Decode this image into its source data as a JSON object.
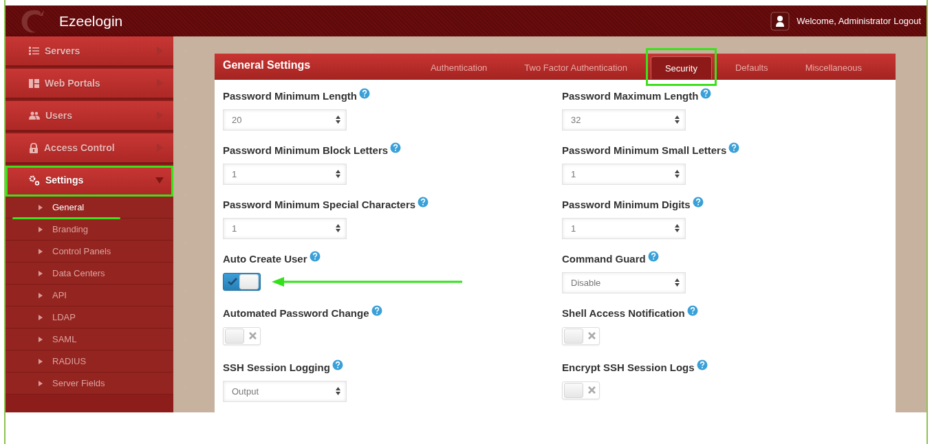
{
  "header": {
    "app_name": "Ezeelogin",
    "welcome": "Welcome, Administrator",
    "logout": "Logout"
  },
  "sidebar": {
    "items": [
      {
        "label": "Servers",
        "expanded": false,
        "highlighted": false
      },
      {
        "label": "Web Portals",
        "expanded": false,
        "highlighted": false
      },
      {
        "label": "Users",
        "expanded": false,
        "highlighted": false
      },
      {
        "label": "Access Control",
        "expanded": false,
        "highlighted": false
      },
      {
        "label": "Settings",
        "expanded": true,
        "highlighted": true,
        "children": [
          {
            "label": "General",
            "selected": true,
            "underlined": true
          },
          {
            "label": "Branding",
            "selected": false,
            "underlined": false
          },
          {
            "label": "Control Panels",
            "selected": false,
            "underlined": false
          },
          {
            "label": "Data Centers",
            "selected": false,
            "underlined": false
          },
          {
            "label": "API",
            "selected": false,
            "underlined": false
          },
          {
            "label": "LDAP",
            "selected": false,
            "underlined": false
          },
          {
            "label": "SAML",
            "selected": false,
            "underlined": false
          },
          {
            "label": "RADIUS",
            "selected": false,
            "underlined": false
          },
          {
            "label": "Server Fields",
            "selected": false,
            "underlined": false
          }
        ]
      }
    ]
  },
  "panel": {
    "title": "General Settings",
    "tabs": [
      {
        "label": "Authentication",
        "selected": false,
        "highlighted": false
      },
      {
        "label": "Two Factor Authentication",
        "selected": false,
        "highlighted": false
      },
      {
        "label": "Security",
        "selected": true,
        "highlighted": true
      },
      {
        "label": "Defaults",
        "selected": false,
        "highlighted": false
      },
      {
        "label": "Miscellaneous",
        "selected": false,
        "highlighted": false
      }
    ],
    "left_fields": [
      {
        "label": "Password Minimum Length",
        "kind": "select",
        "value": "20",
        "annotated": false
      },
      {
        "label": "Password Minimum Block Letters",
        "kind": "select",
        "value": "1",
        "annotated": false
      },
      {
        "label": "Password Minimum Special Characters",
        "kind": "select",
        "value": "1",
        "annotated": false
      },
      {
        "label": "Auto Create User",
        "kind": "toggle",
        "on": true,
        "annotated": true
      },
      {
        "label": "Automated Password Change",
        "kind": "toggle",
        "on": false,
        "annotated": false
      },
      {
        "label": "SSH Session Logging",
        "kind": "select",
        "value": "Output",
        "annotated": false
      }
    ],
    "right_fields": [
      {
        "label": "Password Maximum Length",
        "kind": "select",
        "value": "32",
        "annotated": false
      },
      {
        "label": "Password Minimum Small Letters",
        "kind": "select",
        "value": "1",
        "annotated": false
      },
      {
        "label": "Password Minimum Digits",
        "kind": "select",
        "value": "1",
        "annotated": false
      },
      {
        "label": "Command Guard",
        "kind": "select",
        "value": "Disable",
        "annotated": false
      },
      {
        "label": "Shell Access Notification",
        "kind": "toggle",
        "on": false,
        "annotated": false
      },
      {
        "label": "Encrypt SSH Session Logs",
        "kind": "toggle",
        "on": false,
        "annotated": false
      }
    ]
  }
}
